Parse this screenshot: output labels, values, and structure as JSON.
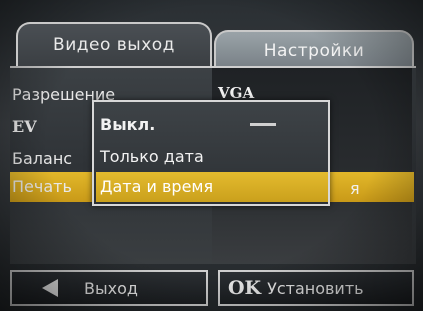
{
  "tabs": {
    "video_out": "Видео выход",
    "settings": "Настройки"
  },
  "menu": {
    "resolution_label": "Разрешение",
    "resolution_value": "VGA",
    "ev_label": "EV",
    "white_balance_label": "Баланс",
    "print_label": "Печать",
    "print_value_tail": "я"
  },
  "popup": {
    "options": [
      "Выкл.",
      "Только дата",
      "Дата и время"
    ],
    "selected_index": 2
  },
  "buttons": {
    "exit_label": "Выход",
    "ok_key": "OK",
    "set_label": "Установить"
  },
  "colors": {
    "highlight": "#d9ad24",
    "border": "#cfcfcf"
  },
  "icons": {
    "exit": "left-triangle-icon"
  }
}
